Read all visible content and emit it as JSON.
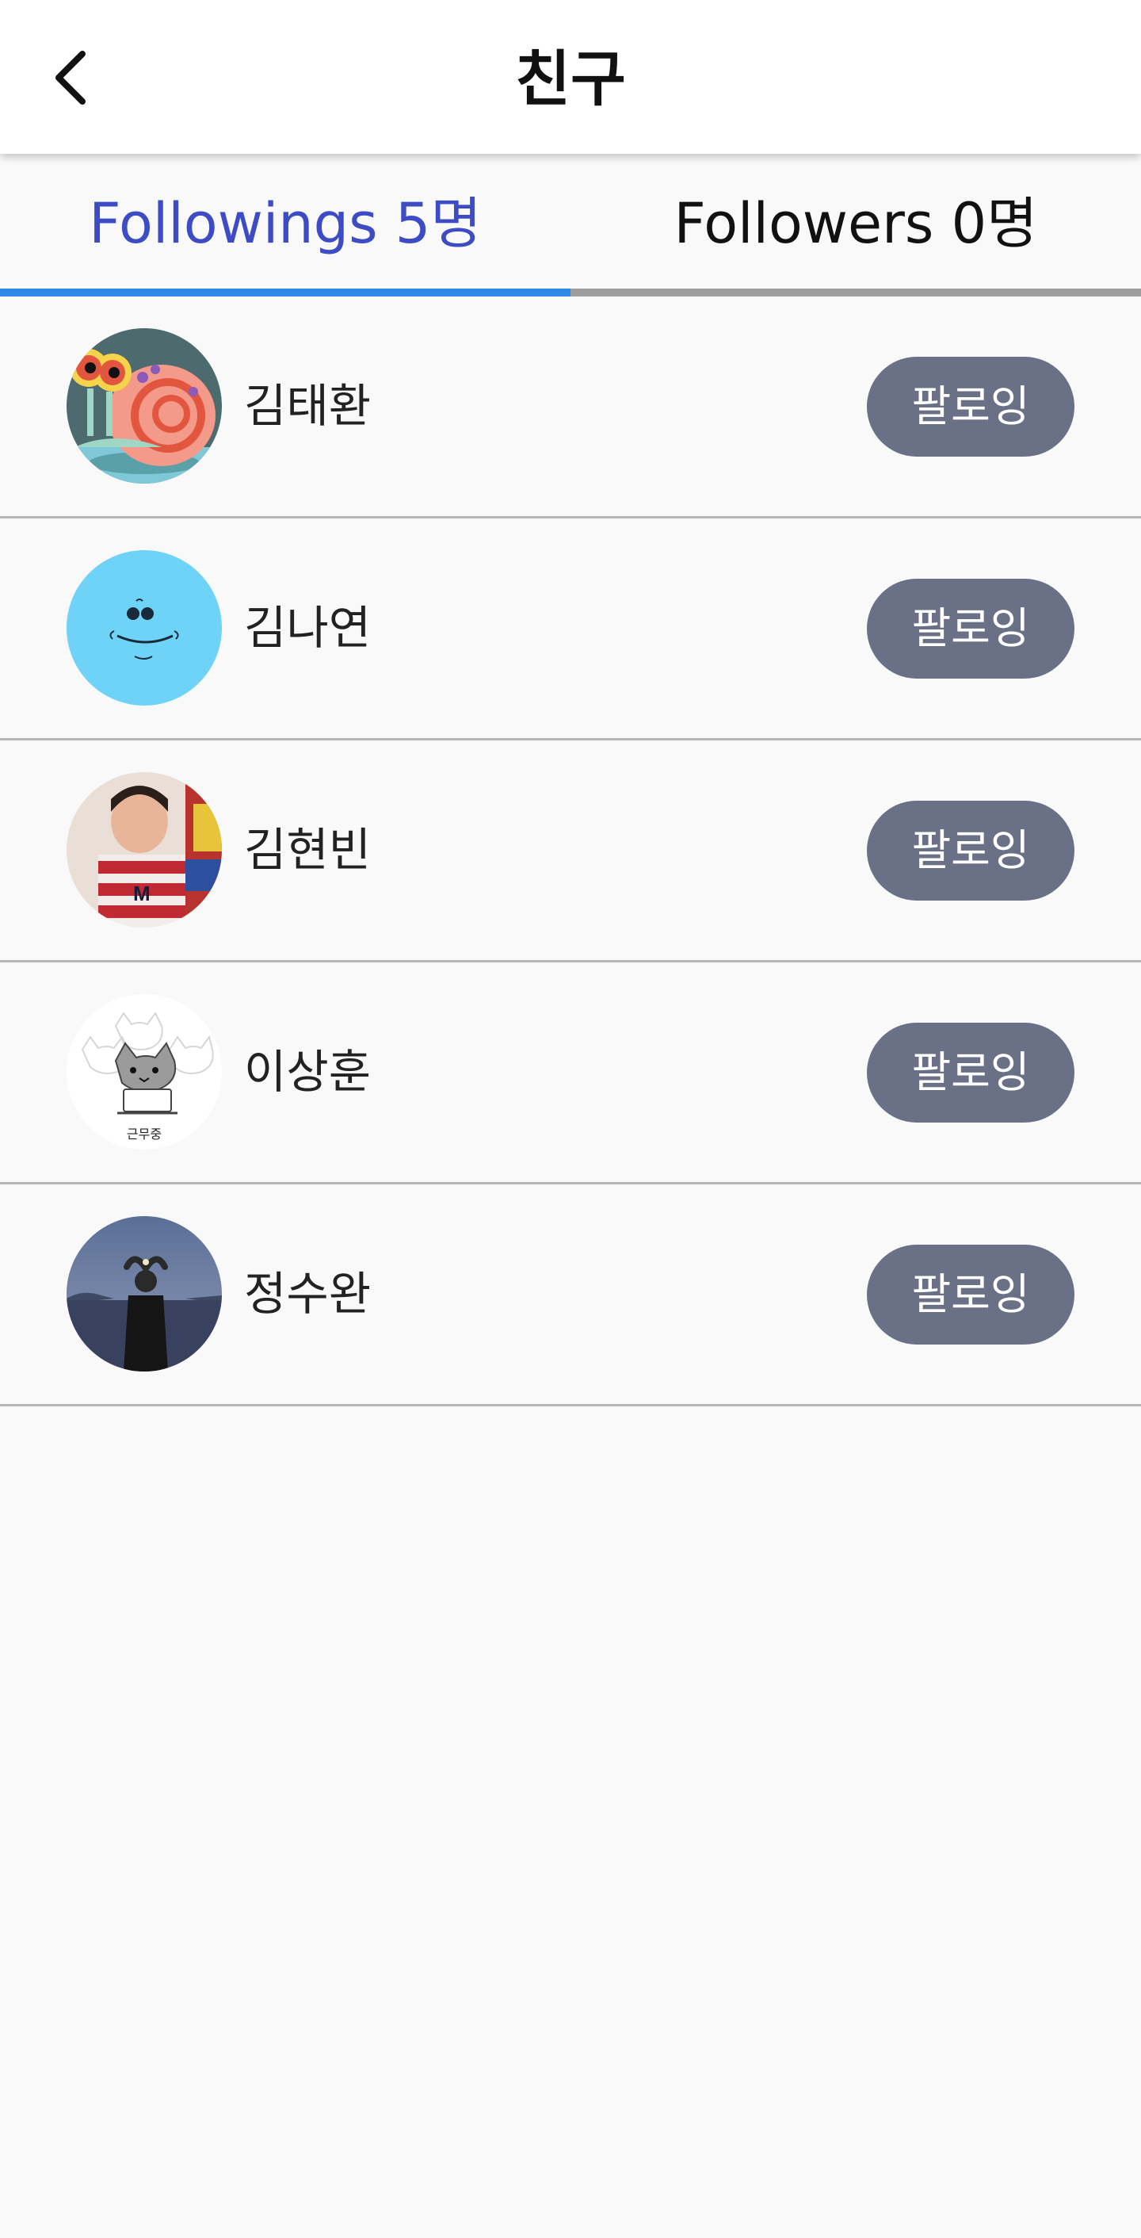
{
  "header": {
    "title": "친구",
    "back_icon": "chevron-left-icon"
  },
  "tabs": [
    {
      "label": "Followings 5명",
      "active": true
    },
    {
      "label": "Followers 0명",
      "active": false
    }
  ],
  "colors": {
    "active_tab_text": "#3d4bc4",
    "active_tab_indicator": "#2e8ae6",
    "inactive_tab_indicator": "#9e9e9e",
    "button_bg": "#6a7086",
    "background": "#f9f9f9"
  },
  "followings": [
    {
      "name": "김태환",
      "button_label": "팔로잉",
      "avatar": "snail-avatar"
    },
    {
      "name": "김나연",
      "button_label": "팔로잉",
      "avatar": "smiley-avatar"
    },
    {
      "name": "김현빈",
      "button_label": "팔로잉",
      "avatar": "child-photo-avatar"
    },
    {
      "name": "이상훈",
      "button_label": "팔로잉",
      "avatar": "cat-drawing-avatar"
    },
    {
      "name": "정수완",
      "button_label": "팔로잉",
      "avatar": "seaside-photo-avatar"
    }
  ]
}
